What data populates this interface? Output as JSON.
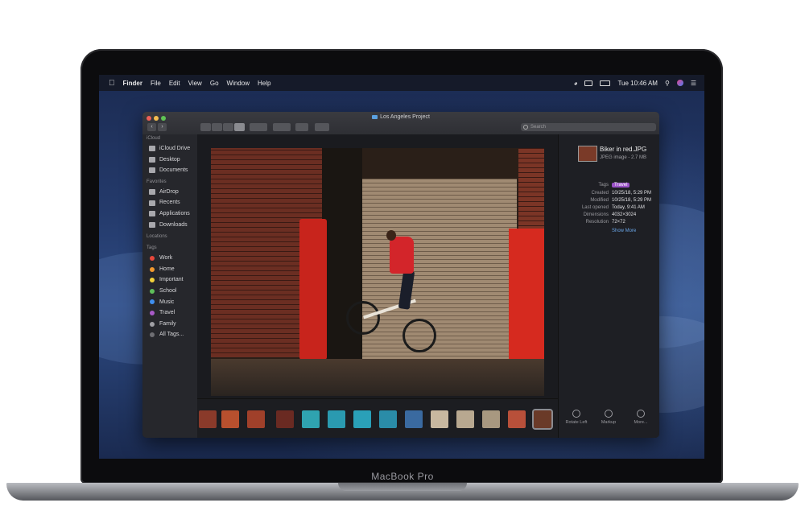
{
  "device": {
    "label": "MacBook Pro"
  },
  "menubar": {
    "apple": "",
    "app": "Finder",
    "items": [
      "File",
      "Edit",
      "View",
      "Go",
      "Window",
      "Help"
    ],
    "clock": "Tue 10:46 AM"
  },
  "window": {
    "title": "Los Angeles Project",
    "search_placeholder": "Search",
    "nav_back": "‹",
    "nav_forward": "›"
  },
  "sidebar": {
    "icloud_header": "iCloud",
    "icloud": [
      "iCloud Drive",
      "Desktop",
      "Documents"
    ],
    "favorites_header": "Favorites",
    "favorites": [
      "AirDrop",
      "Recents",
      "Applications",
      "Downloads"
    ],
    "locations_header": "Locations",
    "tags_header": "Tags",
    "tags": [
      {
        "name": "Work",
        "color": "#e8473b"
      },
      {
        "name": "Home",
        "color": "#f2992e"
      },
      {
        "name": "Important",
        "color": "#f2d13a"
      },
      {
        "name": "School",
        "color": "#5fbf5a"
      },
      {
        "name": "Music",
        "color": "#3f8ff0"
      },
      {
        "name": "Travel",
        "color": "#a85ac8"
      },
      {
        "name": "Family",
        "color": "#a0a0a5"
      },
      {
        "name": "All Tags...",
        "color": "#6e6e73"
      }
    ]
  },
  "inspector": {
    "filename": "Biker in red.JPG",
    "kind": "JPEG image - 2.7 MB",
    "rows": [
      {
        "key": "Tags",
        "value": "Travel"
      },
      {
        "key": "Created",
        "value": "10/25/18, 5:29 PM"
      },
      {
        "key": "Modified",
        "value": "10/25/18, 5:29 PM"
      },
      {
        "key": "Last opened",
        "value": "Today, 9:41 AM"
      },
      {
        "key": "Dimensions",
        "value": "4032×3024"
      },
      {
        "key": "Resolution",
        "value": "72×72"
      }
    ],
    "show_more": "Show More",
    "actions": [
      "Rotate Left",
      "Markup",
      "More..."
    ]
  }
}
